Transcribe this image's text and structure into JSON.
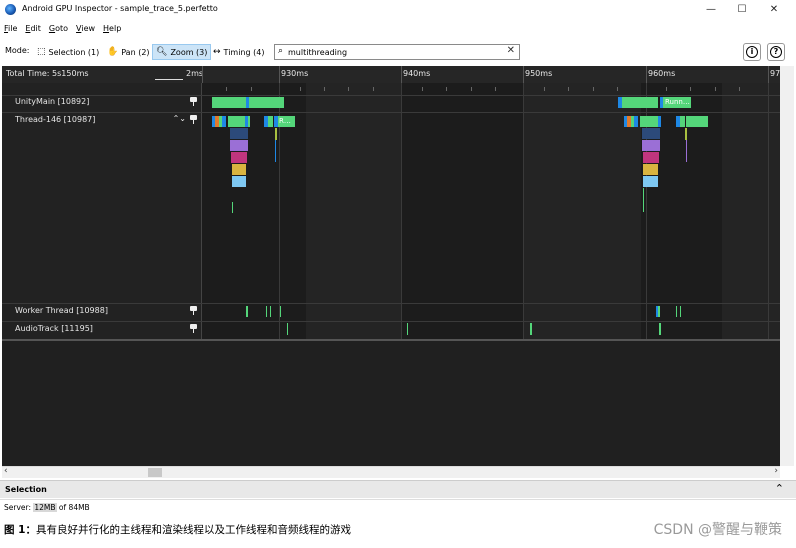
{
  "window": {
    "title": "Android GPU Inspector - sample_trace_5.perfetto",
    "min": "—",
    "max": "☐",
    "close": "✕"
  },
  "menu": [
    {
      "label": "File",
      "u": "F",
      "rest": "ile"
    },
    {
      "label": "Edit",
      "u": "E",
      "rest": "dit"
    },
    {
      "label": "Goto",
      "u": "G",
      "rest": "oto"
    },
    {
      "label": "View",
      "u": "V",
      "rest": "iew"
    },
    {
      "label": "Help",
      "u": "H",
      "rest": "elp"
    }
  ],
  "toolbar": {
    "mode_label": "Mode:",
    "selection": "Selection (1)",
    "pan": "Pan (2)",
    "zoom": "Zoom (3)",
    "timing": "Timing (4)",
    "search_value": "multithreading",
    "info": "i",
    "help": "?"
  },
  "ruler": {
    "total_time": "Total Time: 5s150ms",
    "scale": "2ms",
    "ticks": [
      "930ms",
      "940ms",
      "950ms",
      "960ms",
      "97"
    ]
  },
  "tracks": [
    {
      "name": "UnityMain [10892]"
    },
    {
      "name": "Thread-146 [10987]",
      "expand": "⌃⌄"
    },
    {
      "name": "Worker Thread [10988]"
    },
    {
      "name": "AudioTrack [11195]"
    }
  ],
  "slice_labels": {
    "running1": "Runn…",
    "running2": "R…"
  },
  "selection": {
    "label": "Selection",
    "chevron": "⌃"
  },
  "status": {
    "prefix": "Server: ",
    "mem": "12MB",
    "suffix": " of 84MB"
  },
  "caption": {
    "bold": "图 1：",
    "text": "具有良好并行化的主线程和渲染线程以及工作线程和音频线程的游戏"
  },
  "watermark": "CSDN @警醒与鞭策",
  "colors": {
    "green": "#54d67a",
    "blue": "#1e88e5",
    "navy": "#2c4a7a",
    "purple": "#9b6fd6",
    "magenta": "#c0357e",
    "yellow": "#d9b440",
    "lightblue": "#7ec8f2",
    "olive": "#a8c040",
    "orange": "#e07a2e"
  }
}
